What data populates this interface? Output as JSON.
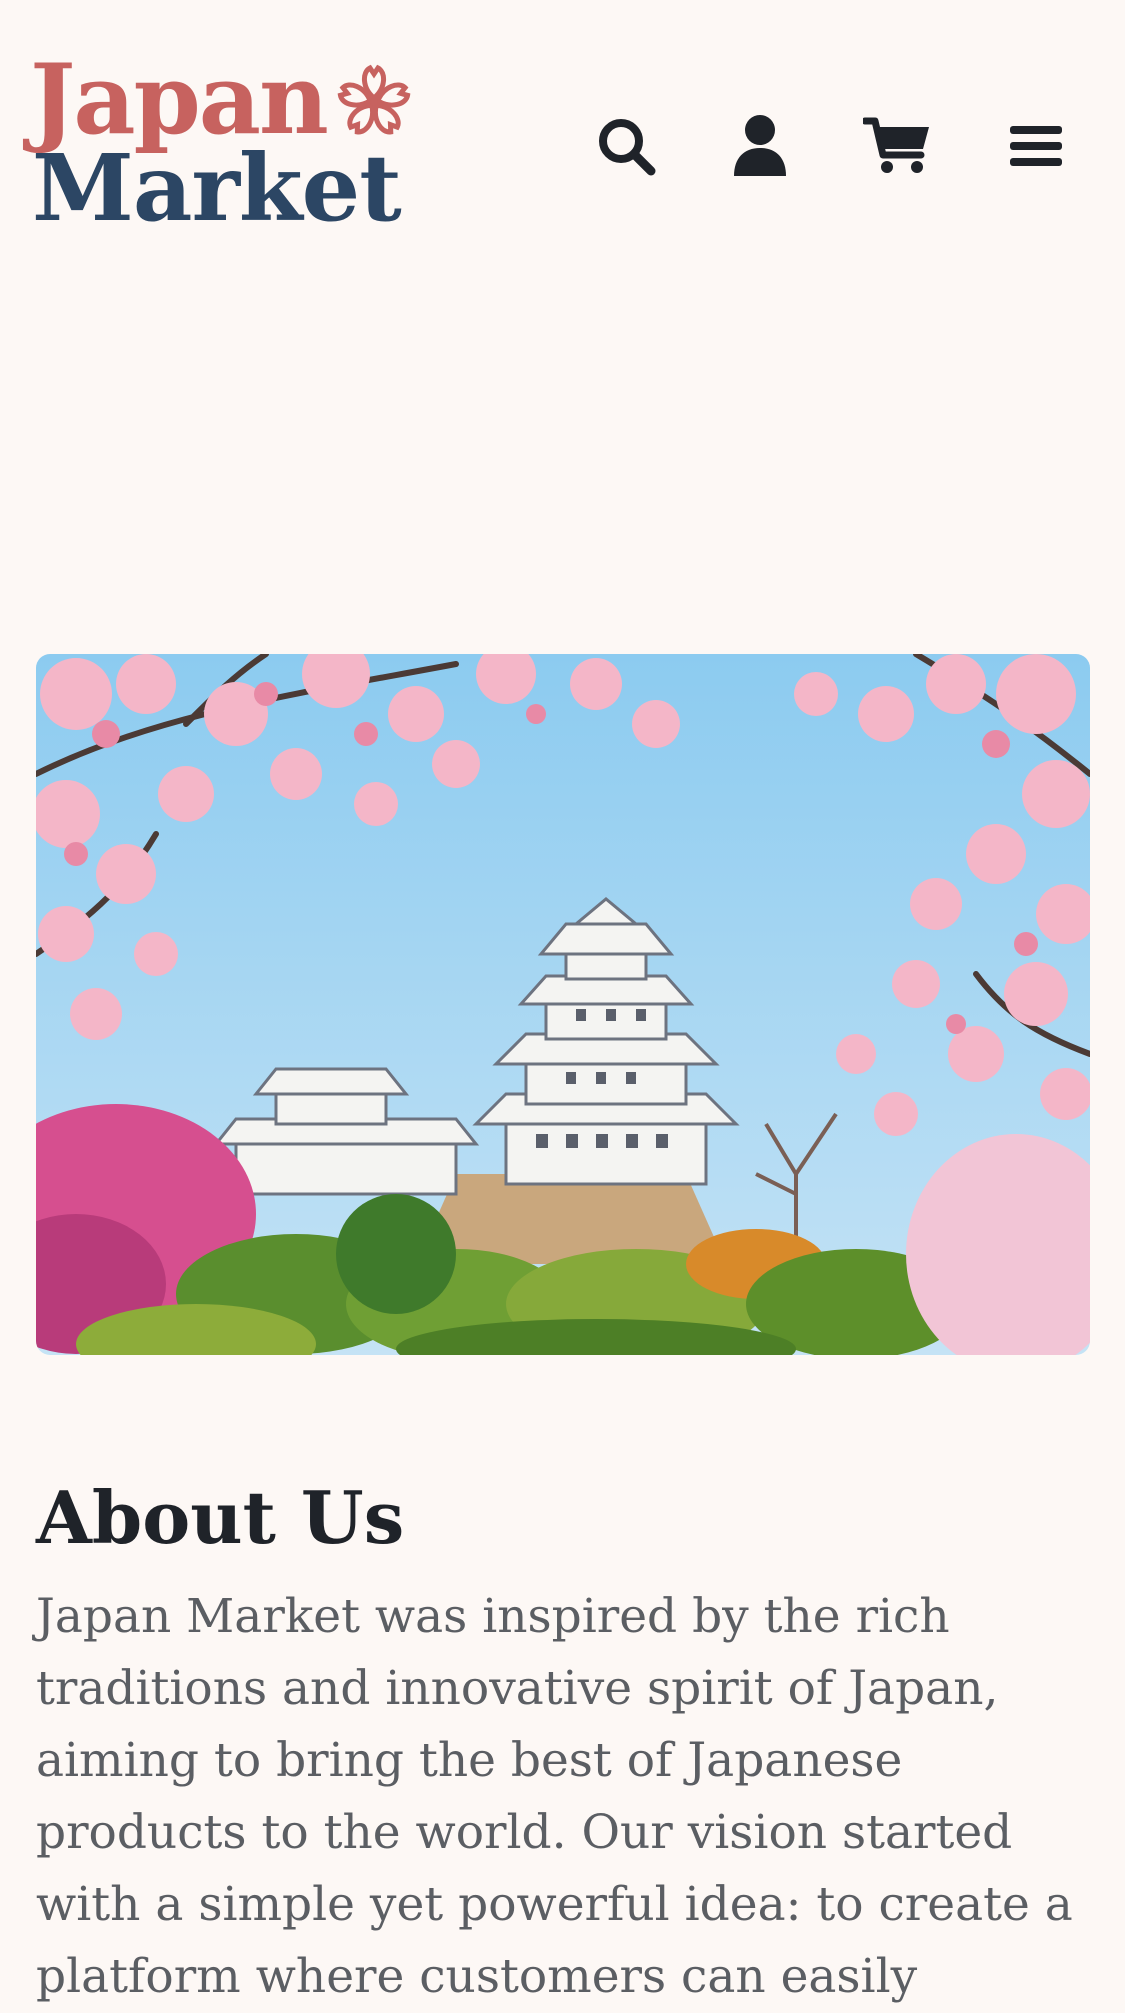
{
  "header": {
    "logo": {
      "line1": "Japan",
      "line2": "Market"
    },
    "icons": {
      "search": "search-icon",
      "account": "user-icon",
      "cart": "cart-icon",
      "menu": "hamburger-menu-icon"
    }
  },
  "hero": {
    "image": "Himeji castle framed by cherry blossoms under blue sky"
  },
  "about": {
    "title": "About Us",
    "body": "Japan Market was inspired by the rich traditions and innovative spirit of Japan, aiming to bring the best of Japanese products to the world. Our vision started with a simple yet powerful idea: to create a platform where customers can easily"
  },
  "colors": {
    "background": "#fdf8f5",
    "logo_pink": "#c7625f",
    "logo_navy": "#2c4664",
    "icon": "#1f2329",
    "heading": "#1f2329",
    "body_text": "#5b5e63"
  }
}
